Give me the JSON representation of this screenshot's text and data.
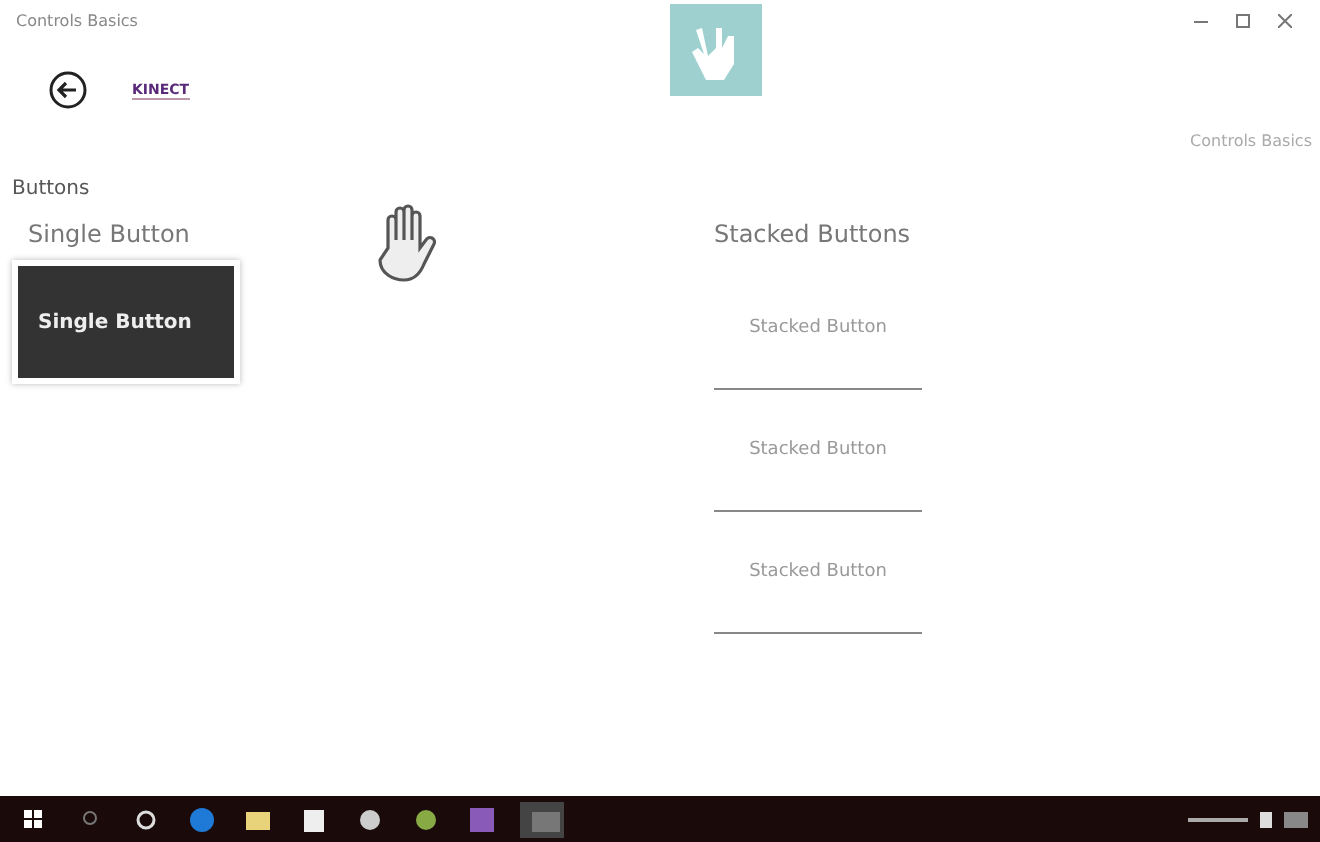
{
  "window": {
    "title": "Controls Basics"
  },
  "header": {
    "logo": "KINECT",
    "page_title": "Controls Basics"
  },
  "section": {
    "title": "Buttons"
  },
  "single": {
    "label": "Single Button",
    "button": "Single Button",
    "pressed": true
  },
  "stacked": {
    "label": "Stacked Buttons",
    "buttons": [
      {
        "label": "Stacked Button"
      },
      {
        "label": "Stacked Button"
      },
      {
        "label": "Stacked Button"
      }
    ]
  },
  "taskbar": {
    "apps": [
      {
        "kind": "start"
      },
      {
        "kind": "search"
      },
      {
        "kind": "taskview"
      },
      {
        "kind": "edge"
      },
      {
        "kind": "explorer"
      },
      {
        "kind": "store"
      },
      {
        "kind": "app"
      },
      {
        "kind": "app2"
      },
      {
        "kind": "studio"
      },
      {
        "kind": "window",
        "selected": true
      }
    ]
  }
}
